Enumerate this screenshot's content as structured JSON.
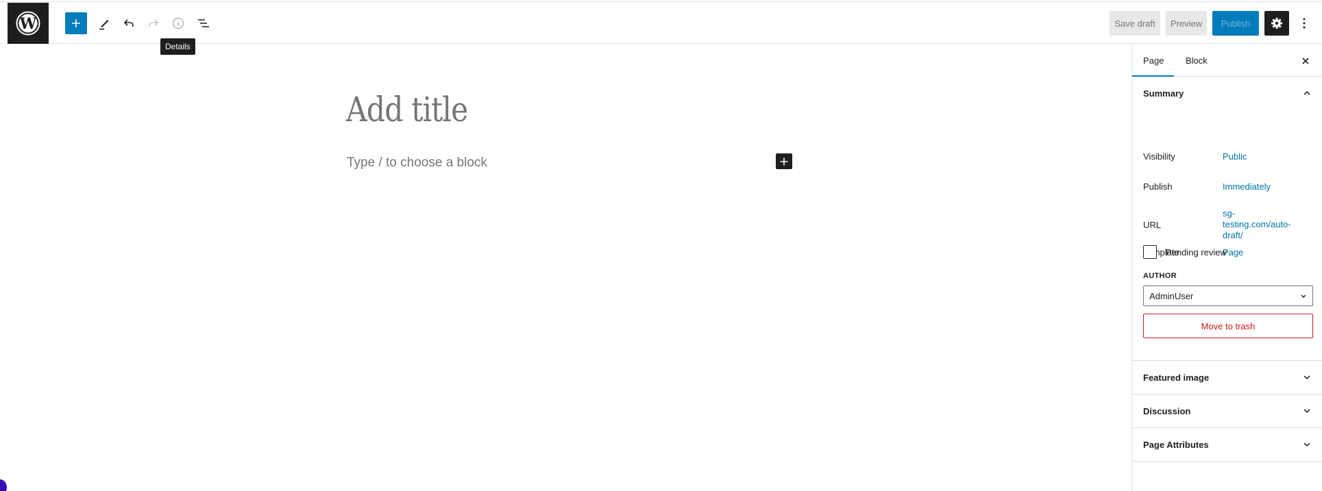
{
  "header": {
    "logo_icon": "wordpress-logo-icon",
    "toolbar": {
      "inserter_icon": "plus-icon",
      "tools_icon": "pencil-icon",
      "undo_icon": "undo-icon",
      "redo_icon": "redo-icon",
      "details_icon": "info-icon",
      "list_view_icon": "list-view-icon"
    },
    "tooltip": "Details",
    "save_draft_label": "Save draft",
    "preview_label": "Preview",
    "publish_label": "Publish",
    "settings_icon": "gear-icon",
    "options_icon": "vertical-ellipsis-icon"
  },
  "editor": {
    "title_placeholder": "Add title",
    "block_placeholder": "Type / to choose a block",
    "inline_inserter_icon": "plus-icon"
  },
  "sidebar": {
    "tabs": [
      {
        "label": "Page",
        "active": true
      },
      {
        "label": "Block",
        "active": false
      }
    ],
    "close_icon": "close-icon",
    "summary": {
      "title": "Summary",
      "expanded": true,
      "rows": [
        {
          "label": "Visibility",
          "value": "Public"
        },
        {
          "label": "Publish",
          "value": "Immediately"
        },
        {
          "label": "URL",
          "value": "sg-testing.com/auto-draft/",
          "value_lines": [
            "sg-",
            "testing.com/auto-",
            "draft/"
          ]
        },
        {
          "label": "Template",
          "value": "Page"
        }
      ],
      "pending_review_label": "Pending review",
      "pending_review_checked": false,
      "author_label": "AUTHOR",
      "author_value": "AdminUser",
      "trash_label": "Move to trash"
    },
    "panels": [
      {
        "title": "Featured image",
        "expanded": false
      },
      {
        "title": "Discussion",
        "expanded": false
      },
      {
        "title": "Page Attributes",
        "expanded": false
      }
    ]
  },
  "colors": {
    "accent": "#007cba",
    "dark": "#1e1e1e",
    "link": "#0073aa",
    "danger": "#cc1818",
    "placeholder": "#757575"
  }
}
